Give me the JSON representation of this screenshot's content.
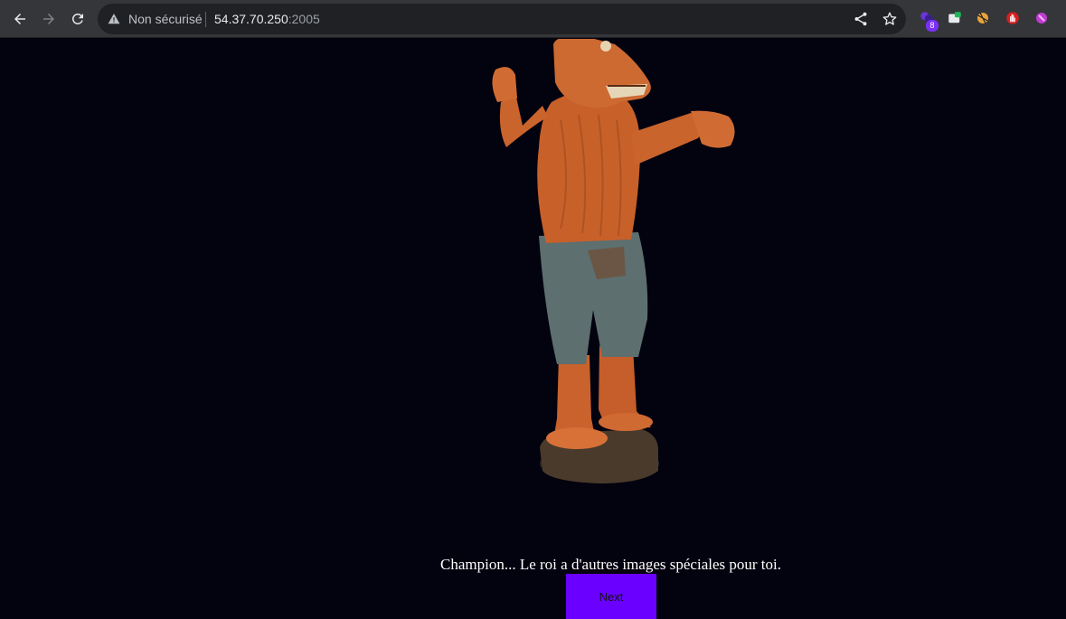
{
  "browser": {
    "security_label": "Non sécurisé",
    "url_host": "54.37.70.250",
    "url_port": ":2005",
    "extension_badge": "8",
    "icons": [
      "back-arrow-icon",
      "forward-arrow-icon",
      "reload-icon",
      "warning-icon",
      "share-icon",
      "star-icon"
    ],
    "extensions": [
      "purple-extension-icon",
      "green-extension-icon",
      "ball-extension-icon",
      "red-hand-extension-icon",
      "pink-extension-icon"
    ]
  },
  "page": {
    "image_alt": "wooden statue",
    "message": "Champion... Le roi a d'autres images spéciales pour toi.",
    "next_label": "Next",
    "accent_color": "#6a00ff",
    "background_color": "#03020f"
  }
}
